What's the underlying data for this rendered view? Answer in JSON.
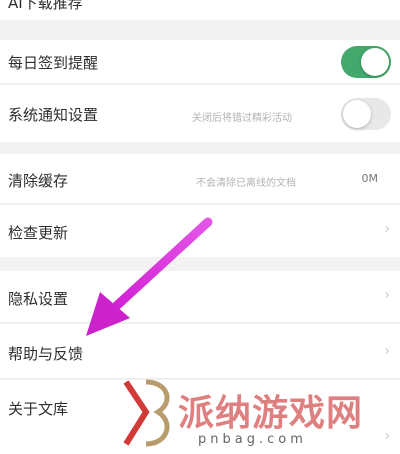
{
  "settings": {
    "top_partial_label": "AI下载推荐",
    "daily_checkin_label": "每日签到提醒",
    "notification_label": "系统通知设置",
    "notification_sub": "关闭后将错过精彩活动",
    "clear_cache_label": "清除缓存",
    "clear_cache_sub": "不会清除已离线的文档",
    "clear_cache_value": "0M",
    "check_update_label": "检查更新",
    "privacy_label": "隐私设置",
    "help_label": "帮助与反馈",
    "about_label": "关于文库",
    "chevron": "›"
  },
  "toggles": {
    "daily_checkin_on": true,
    "notification_on": false
  },
  "colors": {
    "toggle_on": "#43a86c",
    "toggle_off": "#e8e8e8",
    "annotation_arrow": "#cc22cc"
  },
  "watermark": {
    "text": "派纳游戏网",
    "url": "pnbag.com"
  }
}
